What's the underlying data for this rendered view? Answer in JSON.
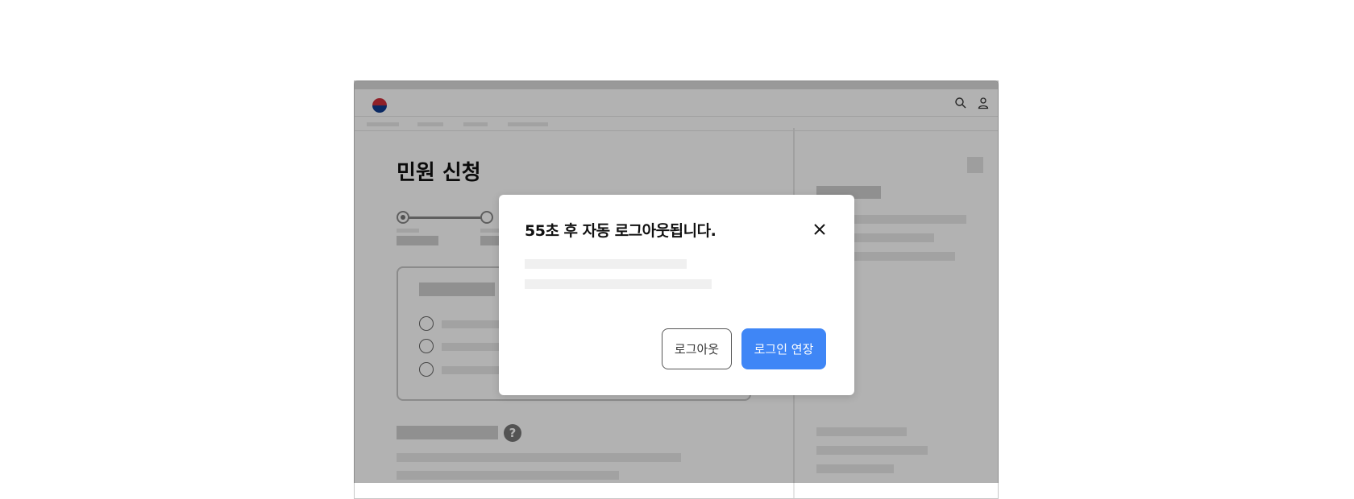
{
  "page": {
    "title": "민원 신청"
  },
  "modal": {
    "title": "55초 후 자동 로그아웃됩니다.",
    "close_icon": "close-icon",
    "buttons": {
      "logout_label": "로그아웃",
      "extend_label": "로그인 연장"
    }
  },
  "header": {
    "logo_icon": "government-emblem-icon",
    "search_icon": "search-icon",
    "user_icon": "user-icon"
  },
  "colors": {
    "primary": "#3f86f6",
    "overlay": "rgba(0,0,0,0.30)"
  }
}
